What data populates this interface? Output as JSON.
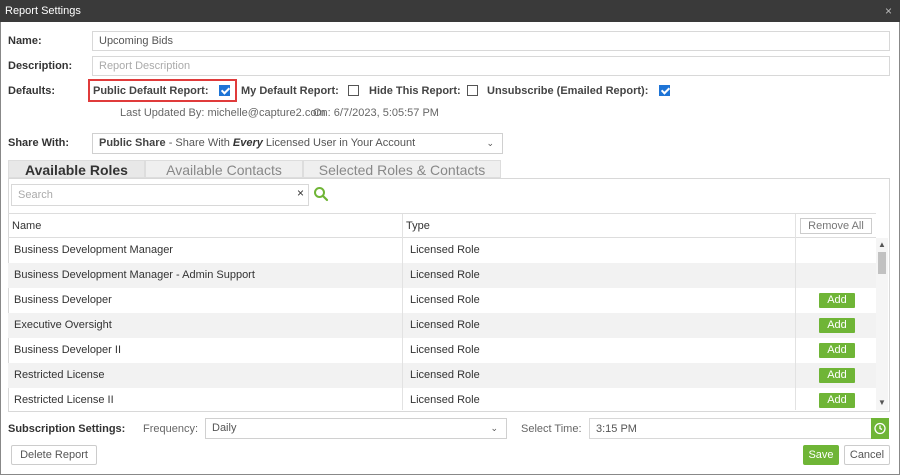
{
  "window": {
    "title": "Report Settings",
    "close_glyph": "×"
  },
  "form": {
    "name_label": "Name:",
    "name_value": "Upcoming Bids",
    "description_label": "Description:",
    "description_placeholder": "Report Description",
    "defaults_label": "Defaults:",
    "options": [
      {
        "label": "Public Default Report:",
        "checked": true
      },
      {
        "label": "My Default Report:",
        "checked": false
      },
      {
        "label": "Hide This Report:",
        "checked": false
      },
      {
        "label": "Unsubscribe (Emailed Report):",
        "checked": true
      }
    ],
    "last_updated": "Last Updated By: michelle@capture2.com",
    "last_updated_on": "On: 6/7/2023, 5:05:57 PM",
    "share_label": "Share With:",
    "share_bold": "Public Share",
    "share_pre": " - Share With ",
    "share_em": "Every",
    "share_post": " Licensed User in Your Account",
    "share_chevron": "⌄"
  },
  "tabs": [
    {
      "label": "Available Roles",
      "active": true
    },
    {
      "label": "Available Contacts",
      "active": false
    },
    {
      "label": "Selected Roles & Contacts",
      "active": false
    }
  ],
  "search": {
    "placeholder": "Search",
    "clear": "×"
  },
  "table": {
    "columns": [
      "Name",
      "Type"
    ],
    "remove_all": "Remove All",
    "add_label": "Add",
    "rows": [
      {
        "name": "Business Development Manager",
        "type": "Licensed Role",
        "action": false
      },
      {
        "name": "Business Development Manager - Admin Support",
        "type": "Licensed Role",
        "action": false
      },
      {
        "name": "Business Developer",
        "type": "Licensed Role",
        "action": true
      },
      {
        "name": "Executive Oversight",
        "type": "Licensed Role",
        "action": true
      },
      {
        "name": "Business Developer II",
        "type": "Licensed Role",
        "action": true
      },
      {
        "name": "Restricted License",
        "type": "Licensed Role",
        "action": true
      },
      {
        "name": "Restricted License II",
        "type": "Licensed Role",
        "action": true
      }
    ]
  },
  "subscription": {
    "label": "Subscription Settings:",
    "frequency_label": "Frequency:",
    "frequency_value": "Daily",
    "time_label": "Select Time:",
    "time_value": "3:15 PM"
  },
  "footer": {
    "delete": "Delete Report",
    "save": "Save",
    "cancel": "Cancel"
  },
  "colors": {
    "accent_green": "#6fb536",
    "title_bar": "#3a3a3a",
    "highlight_red": "#e03b3b",
    "checkbox_blue": "#1e74d6"
  }
}
